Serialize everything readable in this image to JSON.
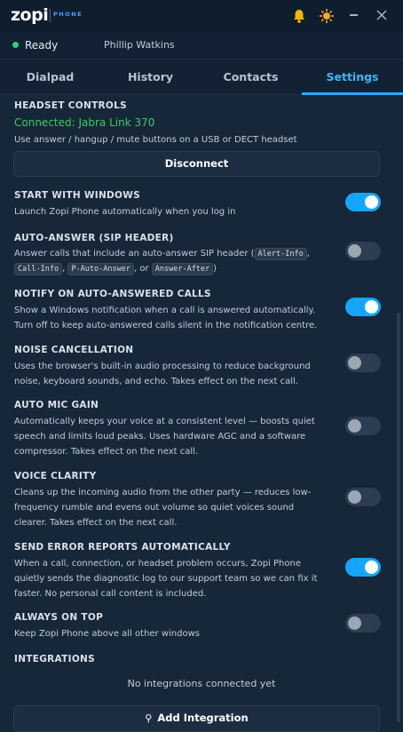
{
  "app": {
    "logo_text": "zopi",
    "logo_sub": "PHONE",
    "bell_icon": "bell-icon",
    "theme_icon": "sun-icon",
    "minimize_icon": "minimize-icon",
    "close_icon": "close-icon"
  },
  "status": {
    "state": "Ready",
    "user": "Phillip Watkins",
    "color": "#2fd17a"
  },
  "tabs": [
    {
      "label": "Dialpad",
      "active": false
    },
    {
      "label": "History",
      "active": false
    },
    {
      "label": "Contacts",
      "active": false
    },
    {
      "label": "Settings",
      "active": true
    }
  ],
  "headset": {
    "title": "HEADSET CONTROLS",
    "connected": "Connected: Jabra Link 370",
    "desc": "Use answer / hangup / mute buttons on a USB or DECT headset",
    "button": "Disconnect"
  },
  "settings": [
    {
      "title": "START WITH WINDOWS",
      "desc": "Launch Zopi Phone automatically when you log in",
      "on": true
    },
    {
      "title": "AUTO-ANSWER (SIP HEADER)",
      "desc_before": "Answer calls that include an auto-answer SIP header (",
      "codes": [
        "Alert-Info",
        "Call-Info",
        "P-Auto-Answer",
        "Answer-After"
      ],
      "sep1": ",",
      "sep2": ",",
      "sep3": ", or",
      "desc_after": ")",
      "on": false
    },
    {
      "title": "NOTIFY ON AUTO-ANSWERED CALLS",
      "desc": "Show a Windows notification when a call is answered automatically. Turn off to keep auto-answered calls silent in the notification centre.",
      "on": true
    },
    {
      "title": "NOISE CANCELLATION",
      "desc": "Uses the browser's built-in audio processing to reduce background noise, keyboard sounds, and echo. Takes effect on the next call.",
      "on": false
    },
    {
      "title": "AUTO MIC GAIN",
      "desc": "Automatically keeps your voice at a consistent level — boosts quiet speech and limits loud peaks. Uses hardware AGC and a software compressor. Takes effect on the next call.",
      "on": false
    },
    {
      "title": "VOICE CLARITY",
      "desc": "Cleans up the incoming audio from the other party — reduces low-frequency rumble and evens out volume so quiet voices sound clearer. Takes effect on the next call.",
      "on": false
    },
    {
      "title": "SEND ERROR REPORTS AUTOMATICALLY",
      "desc": "When a call, connection, or headset problem occurs, Zopi Phone quietly sends the diagnostic log to our support team so we can fix it faster. No personal call content is included.",
      "on": true
    },
    {
      "title": "ALWAYS ON TOP",
      "desc": "Keep Zopi Phone above all other windows",
      "on": false
    }
  ],
  "integrations": {
    "title": "INTEGRATIONS",
    "empty": "No integrations connected yet",
    "button": "Add Integration"
  }
}
